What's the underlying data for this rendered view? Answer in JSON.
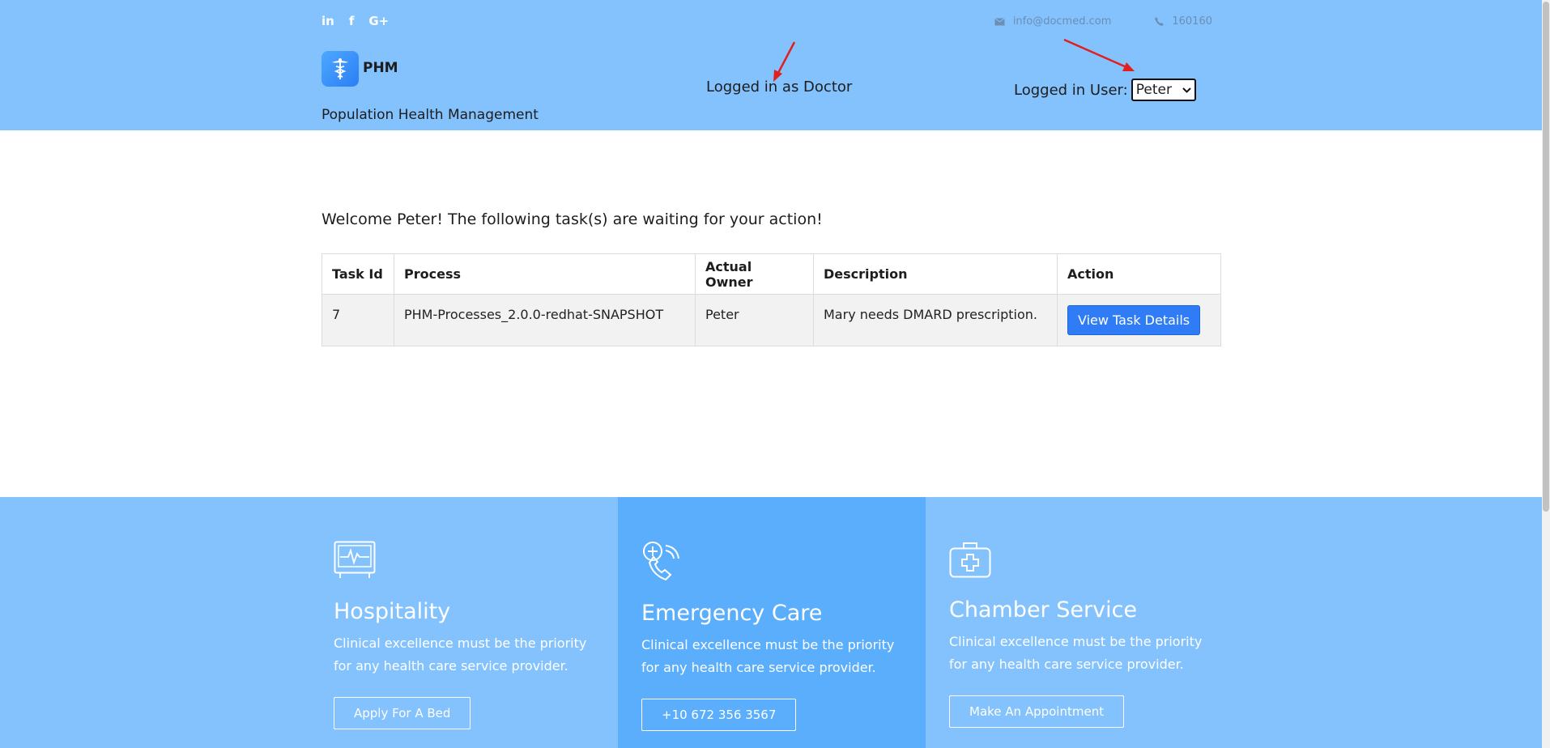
{
  "header": {
    "social_icons": [
      "linkedin-icon",
      "facebook-icon",
      "google-plus-icon"
    ],
    "social_glyphs": [
      "in",
      "f",
      "G+"
    ],
    "email": "info@docmed.com",
    "phone": "160160",
    "brand": "PHM",
    "tagline": "Population Health Management",
    "role_text": "Logged in as Doctor",
    "user_label": "Logged in User:",
    "user_selected": "Peter"
  },
  "main": {
    "welcome": "Welcome Peter! The following task(s) are waiting for your action!",
    "table": {
      "headers": [
        "Task Id",
        "Process",
        "Actual Owner",
        "Description",
        "Action"
      ],
      "rows": [
        {
          "task_id": "7",
          "process": "PHM-Processes_2.0.0-redhat-SNAPSHOT",
          "owner": "Peter",
          "description": "Mary needs DMARD prescription.",
          "action": "View Task Details"
        }
      ]
    }
  },
  "services": [
    {
      "icon": "monitor-heartbeat-icon",
      "title": "Hospitality",
      "text": "Clinical excellence must be the priority for any health care service provider.",
      "button": "Apply For A Bed"
    },
    {
      "icon": "phone-plus-icon",
      "title": "Emergency Care",
      "text": "Clinical excellence must be the priority for any health care service provider.",
      "button": "+10 672 356 3567"
    },
    {
      "icon": "medical-kit-icon",
      "title": "Chamber Service",
      "text": "Clinical excellence must be the priority for any health care service provider.",
      "button": "Make An Appointment"
    }
  ],
  "colors": {
    "header_bg": "#83c2fd",
    "service_highlight": "#5aaefc",
    "primary_button": "#2f7cf6",
    "annotation_arrow": "#e02020"
  }
}
